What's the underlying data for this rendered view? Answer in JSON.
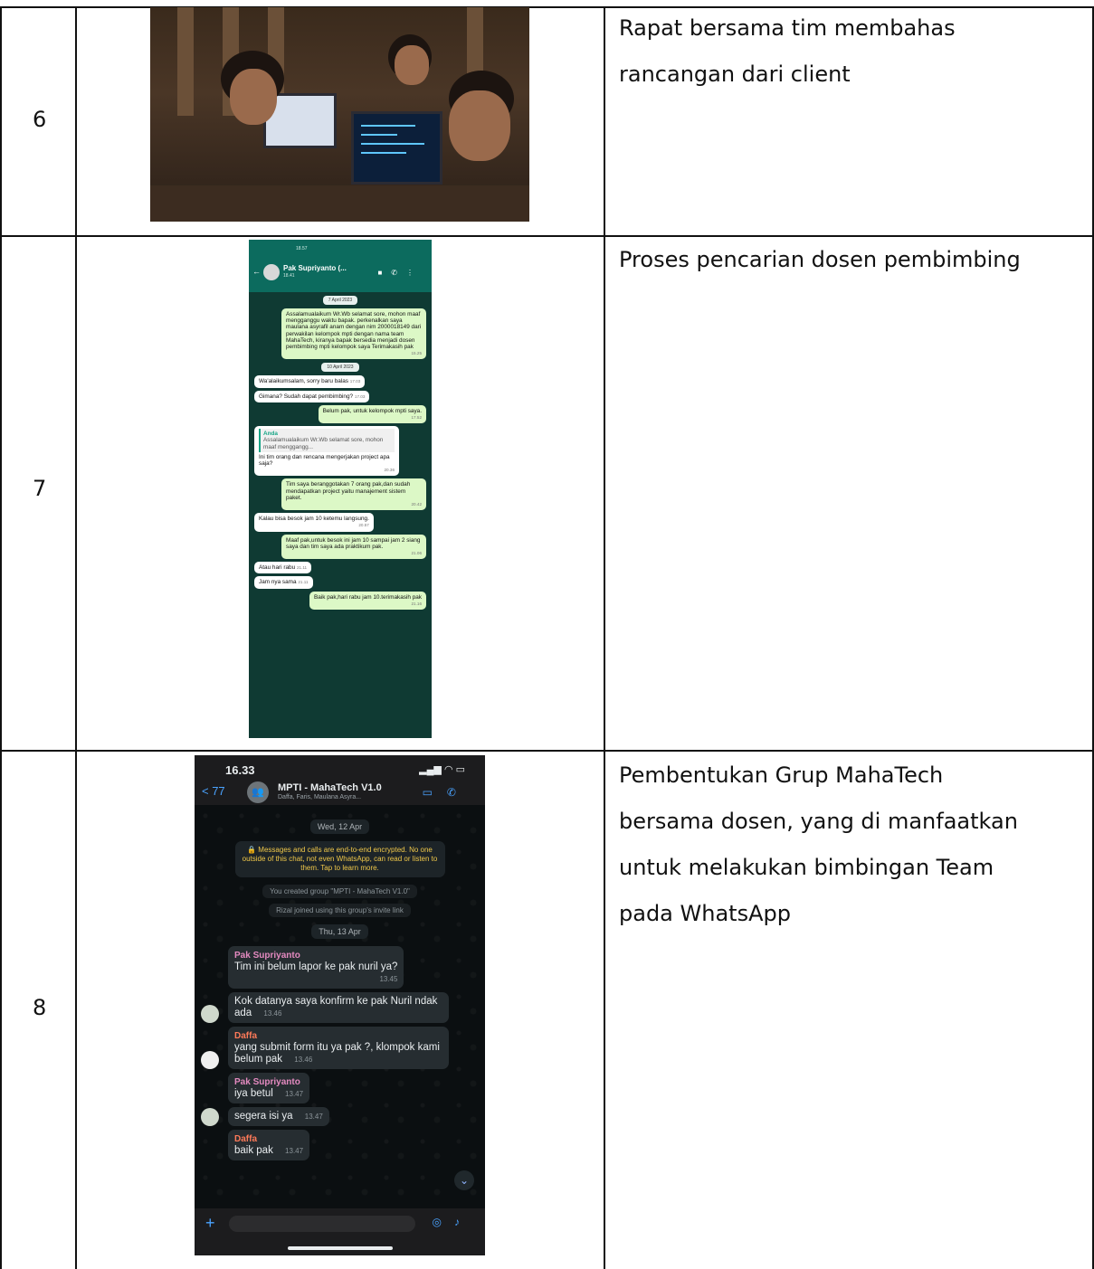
{
  "rows": [
    {
      "number": "6",
      "description_lines": [
        "Rapat bersama tim membahas",
        "rancangan dari client"
      ]
    },
    {
      "number": "7",
      "description_lines": [
        "Proses pencarian dosen pembimbing"
      ],
      "chat": {
        "status_time": "18.57",
        "contact": "Pak Supriyanto (...",
        "last_seen": "18.41",
        "date1": "7 April 2023",
        "msg1": "Assalamualaikum Wr.Wb selamat sore, mohon maaf mengganggu waktu bapak. perkenalkan saya maulana asyrafil anam dengan nim 2000018149 dari perwakilan kelompok mpti dengan nama team MahaTech, kiranya bapak bersedia menjadi dosen pembimbing mpti kelompok saya Terimakasih pak",
        "msg1_time": "15.25",
        "date2": "10 April 2023",
        "msg2": "Wa'alaikumsalam, sorry baru balas",
        "msg2_time": "17.03",
        "msg3": "Gimana? Sudah dapat pembimbing?",
        "msg3_time": "17.03",
        "msg4": "Belum pak, untuk kelompok mpti saya.",
        "msg4_time": "17.52",
        "quote_author": "Anda",
        "quote_text": "Assalamualaikum Wr.Wb selamat sore, mohon maaf menggangg...",
        "msg5": "Ini tim orang dan rencana mengerjakan project apa saja?",
        "msg5_time": "20.36",
        "msg6": "Tim saya beranggotakan 7 orang pak,dan sudah mendapatkan project yaitu manajement sistem paket.",
        "msg6_time": "20.42",
        "msg7": "Kalau bisa besok jam 10 ketemu langsung.",
        "msg7_time": "20.57",
        "msg8": "Maaf pak,untuk besok ini jam 10 sampai jam 2 siang saya dan tim saya ada praktikum pak.",
        "msg8_time": "21.06",
        "msg9": "Atau hari rabu",
        "msg9_time": "21.11",
        "msg10": "Jam nya sama",
        "msg10_time": "21.11",
        "msg11": "Baik pak,hari rabu jam 10.terimakasih pak",
        "msg11_time": "21.16"
      }
    },
    {
      "number": "8",
      "description_lines": [
        "Pembentukan Grup MahaTech",
        "bersama dosen, yang di manfaatkan",
        "untuk melakukan bimbingan Team",
        "pada WhatsApp"
      ],
      "chat": {
        "clock": "16.33",
        "back_count": "< 77",
        "group_name": "MPTI - MahaTech V1.0",
        "members": "Daffa, Faris, Maulana Asyra...",
        "date1": "Wed, 12 Apr",
        "encryption": "🔒 Messages and calls are end-to-end encrypted. No one outside of this chat, not even WhatsApp, can read or listen to them. Tap to learn more.",
        "sys1": "You created group \"MPTI - MahaTech V1.0\"",
        "sys2": "Rizal joined using this group's invite link",
        "date2": "Thu, 13 Apr",
        "sender_ps": "Pak Supriyanto",
        "sender_df": "Daffa",
        "m1": "Tim ini belum lapor ke pak nuril ya?",
        "m1_time": "13.45",
        "m2": "Kok datanya saya konfirm ke pak Nuril ndak ada",
        "m2_time": "13.46",
        "m3": "yang submit form itu ya pak ?, klompok kami belum pak",
        "m3_time": "13.46",
        "m4": "iya betul",
        "m4_time": "13.47",
        "m5": "segera isi ya",
        "m5_time": "13.47",
        "m6": "baik pak",
        "m6_time": "13.47"
      }
    }
  ]
}
